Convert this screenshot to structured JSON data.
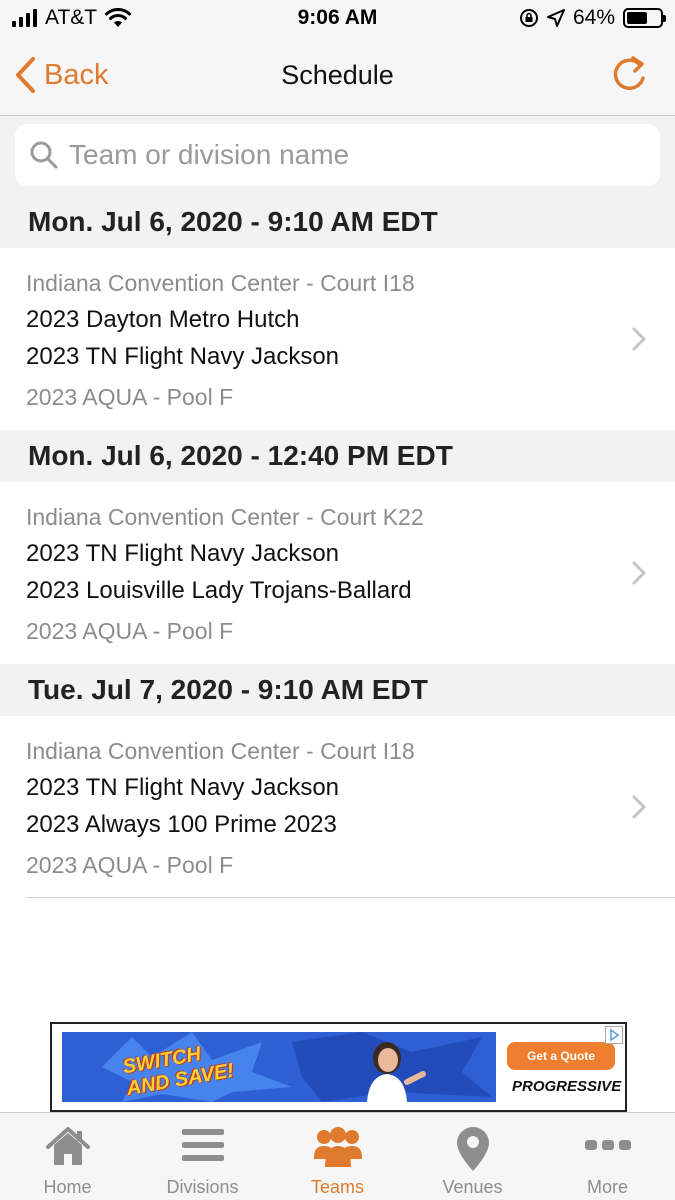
{
  "status_bar": {
    "carrier": "AT&T",
    "time": "9:06 AM",
    "battery": "64%",
    "battery_level": 0.64,
    "signal_icon": "signal-bars-icon",
    "wifi_icon": "wifi-icon",
    "rotation_lock_icon": "rotation-lock-icon",
    "location_icon": "location-arrow-icon"
  },
  "nav": {
    "back_label": "Back",
    "title": "Schedule",
    "refresh_icon": "refresh-icon"
  },
  "search": {
    "placeholder": "Team or division name",
    "value": ""
  },
  "sections": [
    {
      "header": "Mon. Jul 6, 2020 - 9:10 AM EDT",
      "venue": "Indiana Convention Center - Court I18",
      "team1": "2023 Dayton Metro Hutch",
      "team2": "2023 TN Flight Navy Jackson",
      "pool": "2023 AQUA - Pool F"
    },
    {
      "header": "Mon. Jul 6, 2020 - 12:40 PM EDT",
      "venue": "Indiana Convention Center - Court K22",
      "team1": "2023 TN Flight Navy Jackson",
      "team2": "2023 Louisville Lady Trojans-Ballard",
      "pool": "2023 AQUA - Pool F"
    },
    {
      "header": "Tue. Jul 7, 2020 - 9:10 AM EDT",
      "venue": "Indiana Convention Center - Court I18",
      "team1": "2023 TN Flight Navy Jackson",
      "team2": "2023 Always 100 Prime 2023",
      "pool": "2023 AQUA - Pool F"
    }
  ],
  "ad": {
    "slogan": "SWITCH AND SAVE!",
    "cta": "Get a Quote",
    "brand": "PROGRESSIVE"
  },
  "tabs": [
    {
      "label": "Home",
      "icon": "home-icon",
      "active": false
    },
    {
      "label": "Divisions",
      "icon": "list-icon",
      "active": false
    },
    {
      "label": "Teams",
      "icon": "people-icon",
      "active": true
    },
    {
      "label": "Venues",
      "icon": "map-pin-icon",
      "active": false
    },
    {
      "label": "More",
      "icon": "more-dots-icon",
      "active": false
    }
  ],
  "colors": {
    "accent": "#e07a2e",
    "section_bg": "#f2f2f2",
    "secondary_text": "#8c8c8c",
    "tab_inactive": "#8e8e8e"
  }
}
